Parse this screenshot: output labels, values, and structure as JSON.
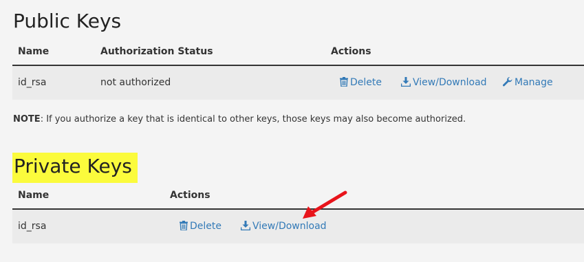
{
  "public_keys": {
    "title": "Public Keys",
    "columns": {
      "name": "Name",
      "status": "Authorization Status",
      "actions": "Actions"
    },
    "rows": [
      {
        "name": "id_rsa",
        "status": "not authorized",
        "delete_label": "Delete",
        "download_label": "View/Download",
        "manage_label": "Manage"
      }
    ]
  },
  "note": {
    "label": "NOTE",
    "text": ": If you authorize a key that is identical to other keys, those keys may also become authorized."
  },
  "private_keys": {
    "title": "Private Keys",
    "highlight_color": "#fbfb3c",
    "columns": {
      "name": "Name",
      "actions": "Actions"
    },
    "rows": [
      {
        "name": "id_rsa",
        "delete_label": "Delete",
        "download_label": "View/Download"
      }
    ]
  },
  "colors": {
    "link": "#337ab7",
    "row_background": "#ebebeb",
    "annotation_arrow": "#e8141b"
  },
  "icons": {
    "delete": "trash-icon",
    "download": "download-icon",
    "manage": "wrench-icon"
  }
}
